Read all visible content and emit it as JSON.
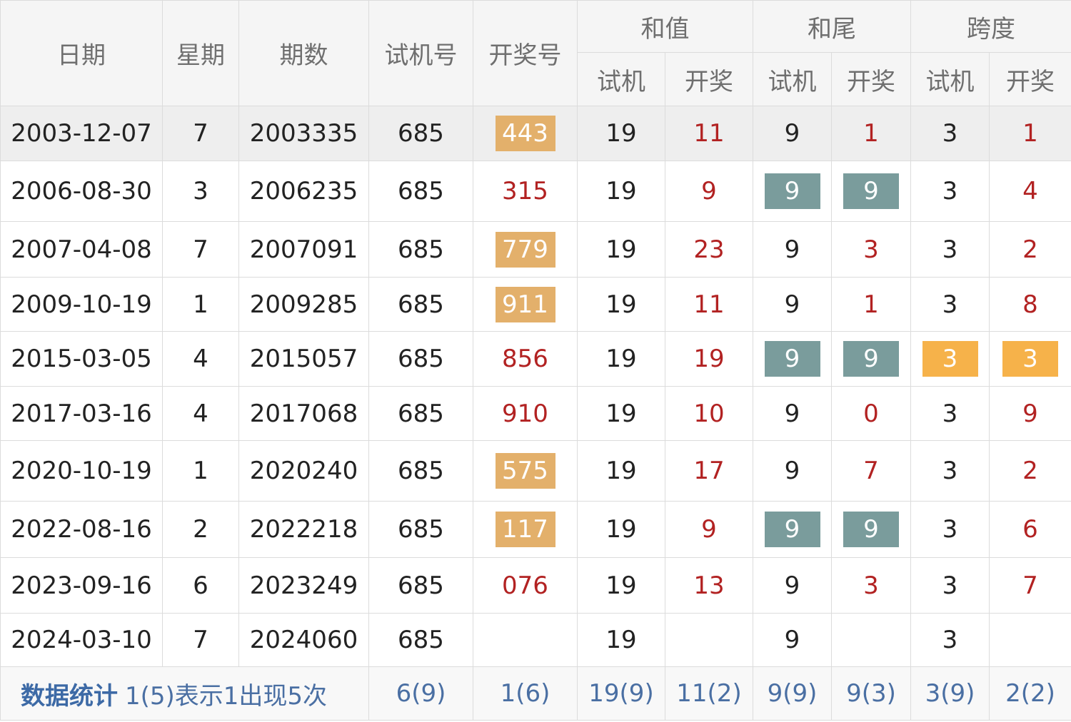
{
  "headers": {
    "date": "日期",
    "weekday": "星期",
    "issue": "期数",
    "test_number": "试机号",
    "draw_number": "开奖号",
    "sum_group": "和值",
    "tail_group": "和尾",
    "span_group": "跨度",
    "sub_test": "试机",
    "sub_draw": "开奖"
  },
  "rows": [
    {
      "date": "2003-12-07",
      "weekday": "7",
      "issue": "2003335",
      "test": "685",
      "draw": "443",
      "draw_box": "orange",
      "sum_test": "19",
      "sum_draw": "11",
      "tail_test": "9",
      "tail_test_box": "",
      "tail_draw": "1",
      "tail_draw_box": "",
      "span_test": "3",
      "span_test_box": "",
      "span_draw": "1",
      "span_draw_box": ""
    },
    {
      "date": "2006-08-30",
      "weekday": "3",
      "issue": "2006235",
      "test": "685",
      "draw": "315",
      "draw_box": "",
      "sum_test": "19",
      "sum_draw": "9",
      "tail_test": "9",
      "tail_test_box": "teal",
      "tail_draw": "9",
      "tail_draw_box": "teal",
      "span_test": "3",
      "span_test_box": "",
      "span_draw": "4",
      "span_draw_box": ""
    },
    {
      "date": "2007-04-08",
      "weekday": "7",
      "issue": "2007091",
      "test": "685",
      "draw": "779",
      "draw_box": "orange",
      "sum_test": "19",
      "sum_draw": "23",
      "tail_test": "9",
      "tail_test_box": "",
      "tail_draw": "3",
      "tail_draw_box": "",
      "span_test": "3",
      "span_test_box": "",
      "span_draw": "2",
      "span_draw_box": ""
    },
    {
      "date": "2009-10-19",
      "weekday": "1",
      "issue": "2009285",
      "test": "685",
      "draw": "911",
      "draw_box": "orange",
      "sum_test": "19",
      "sum_draw": "11",
      "tail_test": "9",
      "tail_test_box": "",
      "tail_draw": "1",
      "tail_draw_box": "",
      "span_test": "3",
      "span_test_box": "",
      "span_draw": "8",
      "span_draw_box": ""
    },
    {
      "date": "2015-03-05",
      "weekday": "4",
      "issue": "2015057",
      "test": "685",
      "draw": "856",
      "draw_box": "",
      "sum_test": "19",
      "sum_draw": "19",
      "tail_test": "9",
      "tail_test_box": "teal",
      "tail_draw": "9",
      "tail_draw_box": "teal",
      "span_test": "3",
      "span_test_box": "yellow",
      "span_draw": "3",
      "span_draw_box": "yellow"
    },
    {
      "date": "2017-03-16",
      "weekday": "4",
      "issue": "2017068",
      "test": "685",
      "draw": "910",
      "draw_box": "",
      "sum_test": "19",
      "sum_draw": "10",
      "tail_test": "9",
      "tail_test_box": "",
      "tail_draw": "0",
      "tail_draw_box": "",
      "span_test": "3",
      "span_test_box": "",
      "span_draw": "9",
      "span_draw_box": ""
    },
    {
      "date": "2020-10-19",
      "weekday": "1",
      "issue": "2020240",
      "test": "685",
      "draw": "575",
      "draw_box": "orange",
      "sum_test": "19",
      "sum_draw": "17",
      "tail_test": "9",
      "tail_test_box": "",
      "tail_draw": "7",
      "tail_draw_box": "",
      "span_test": "3",
      "span_test_box": "",
      "span_draw": "2",
      "span_draw_box": ""
    },
    {
      "date": "2022-08-16",
      "weekday": "2",
      "issue": "2022218",
      "test": "685",
      "draw": "117",
      "draw_box": "orange",
      "sum_test": "19",
      "sum_draw": "9",
      "tail_test": "9",
      "tail_test_box": "teal",
      "tail_draw": "9",
      "tail_draw_box": "teal",
      "span_test": "3",
      "span_test_box": "",
      "span_draw": "6",
      "span_draw_box": ""
    },
    {
      "date": "2023-09-16",
      "weekday": "6",
      "issue": "2023249",
      "test": "685",
      "draw": "076",
      "draw_box": "",
      "sum_test": "19",
      "sum_draw": "13",
      "tail_test": "9",
      "tail_test_box": "",
      "tail_draw": "3",
      "tail_draw_box": "",
      "span_test": "3",
      "span_test_box": "",
      "span_draw": "7",
      "span_draw_box": ""
    },
    {
      "date": "2024-03-10",
      "weekday": "7",
      "issue": "2024060",
      "test": "685",
      "draw": "",
      "draw_box": "",
      "sum_test": "19",
      "sum_draw": "",
      "tail_test": "9",
      "tail_test_box": "",
      "tail_draw": "",
      "tail_draw_box": "",
      "span_test": "3",
      "span_test_box": "",
      "span_draw": "",
      "span_draw_box": ""
    }
  ],
  "footer": {
    "title": "数据统计",
    "note": "1(5)表示1出现5次",
    "test": "6(9)",
    "draw": "1(6)",
    "sum_test": "19(9)",
    "sum_draw": "11(2)",
    "tail_test": "9(9)",
    "tail_draw": "9(3)",
    "span_test": "3(9)",
    "span_draw": "2(2)"
  },
  "colors": {
    "orange_box": "#e3b06b",
    "teal_box": "#7a9c9c",
    "yellow_box": "#f6b24a",
    "red_text": "#b22222",
    "footer_text": "#4a6fa3"
  }
}
